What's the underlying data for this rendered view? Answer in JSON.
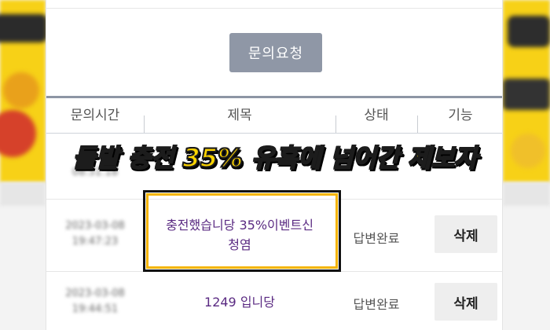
{
  "toolbar": {
    "inquiry_button": "문의요청"
  },
  "table": {
    "headers": [
      "문의시간",
      "제목",
      "상태",
      "기능"
    ],
    "rows": [
      {
        "time": "2023-03-08",
        "clock": "08:51:18",
        "title": "",
        "status": "",
        "action": ""
      },
      {
        "time": "2023-03-08",
        "clock": "19:47:23",
        "title_line1": "충전했습니당 35%이벤트신",
        "title_line2": "청염",
        "status": "답변완료",
        "action": "삭제"
      },
      {
        "time": "2023-03-08",
        "clock": "19:44:51",
        "title": "1249 입니당",
        "status": "답변완료",
        "action": "삭제"
      }
    ]
  },
  "headline": {
    "part1": "돌발 충전 35% 유혹",
    "part2": "에",
    "part3": " 넘어간 제보자",
    "colors": {
      "main": "#ffd500",
      "accent": "#ff3b1f",
      "stroke": "#1c1c1c"
    }
  },
  "colors": {
    "button_bg": "#8f97a6",
    "title_text": "#5a2a82",
    "highlight_border": "#f5b400"
  }
}
